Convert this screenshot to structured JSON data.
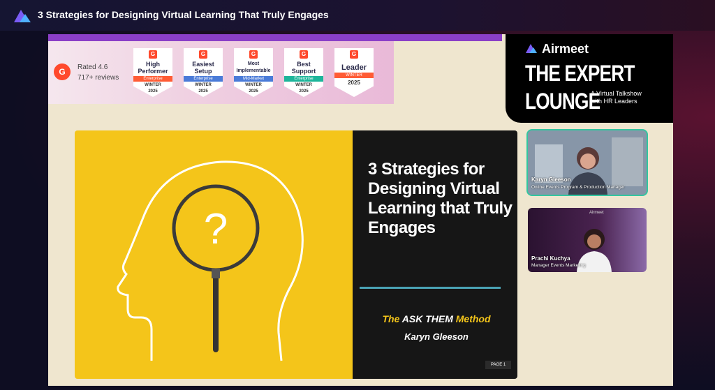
{
  "header": {
    "title": "3 Strategies for Designing Virtual Learning That Truly Engages",
    "logo_icon": "airmeet-logo-icon"
  },
  "g2_banner": {
    "logo_text": "G",
    "rating": "Rated 4.6",
    "reviews": "717+ reviews",
    "badges": [
      {
        "title": "High Performer",
        "segment": "Enterprise",
        "season": "WINTER",
        "year": "2025",
        "segment_color": "#ff5c35"
      },
      {
        "title": "Easiest Setup",
        "segment": "Enterprise",
        "season": "WINTER",
        "year": "2025",
        "segment_color": "#4a7bd8"
      },
      {
        "title": "Most Implementable",
        "segment": "Mid-Market",
        "season": "WINTER",
        "year": "2025",
        "segment_color": "#4a7bd8"
      },
      {
        "title": "Best Support",
        "segment": "Enterprise",
        "season": "WINTER",
        "year": "2025",
        "segment_color": "#1db59a"
      },
      {
        "title": "Leader",
        "segment": "WINTER",
        "season": "",
        "year": "2025",
        "segment_color": "#ff5c35"
      }
    ]
  },
  "lounge": {
    "brand": "Airmeet",
    "headline_1": "THE EXPERT",
    "headline_2": "LOUNGE",
    "subtitle": "A Virtual Talkshow with HR Leaders"
  },
  "slide": {
    "title": "3 Strategies for Designing Virtual Learning that Truly Engages",
    "method_pre": "The",
    "method_mid": " ASK THEM ",
    "method_post": "Method",
    "presenter": "Karyn Gleeson",
    "page": "PAGE 1"
  },
  "participants": [
    {
      "name": "Karyn Gleeson",
      "role": "Online Events Program & Production Manager"
    },
    {
      "name": "Prachi Kuchya",
      "role": "Manager Events Marketing",
      "brand": "Airmeet"
    }
  ],
  "colors": {
    "accent_purple": "#8b3fc7",
    "slide_yellow": "#f4c51a",
    "active_speaker": "#33c6a0"
  }
}
